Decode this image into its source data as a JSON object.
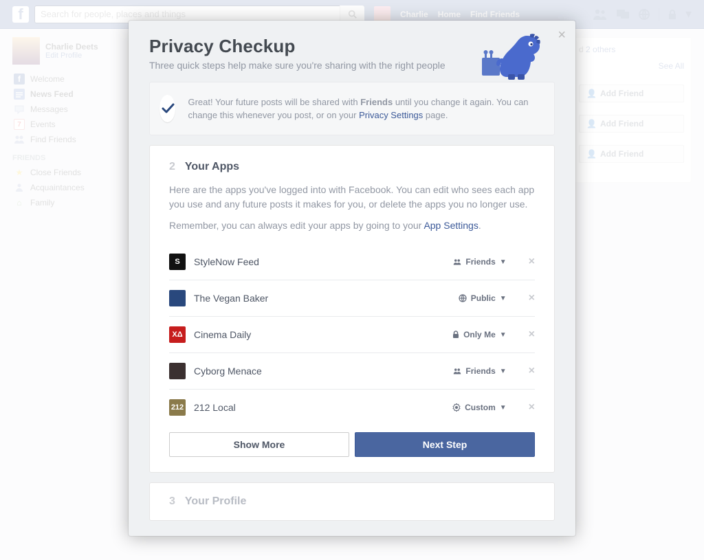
{
  "search": {
    "placeholder": "Search for people, places and things"
  },
  "nav": {
    "username": "Charlie",
    "home": "Home",
    "find_friends": "Find Friends"
  },
  "profile": {
    "name": "Charlie Deets",
    "edit": "Edit Profile"
  },
  "sidebar": {
    "items": [
      {
        "label": "Welcome"
      },
      {
        "label": "News Feed"
      },
      {
        "label": "Messages"
      },
      {
        "label": "Events"
      },
      {
        "label": "Find Friends"
      }
    ],
    "friends_header": "FRIENDS",
    "friends": [
      {
        "label": "Close Friends"
      },
      {
        "label": "Acquaintances"
      },
      {
        "label": "Family"
      }
    ]
  },
  "right": {
    "text_prefix": "d ",
    "see_all": "See All",
    "others_link": "2 others",
    "add_friend": "Add Friend"
  },
  "modal": {
    "title": "Privacy Checkup",
    "subtitle": "Three quick steps help make sure you're sharing with the right people",
    "banner": {
      "pre": "Great! Your future posts will be shared with ",
      "bold": "Friends",
      "mid": " until you change it again. You can change this whenever you post, or on your ",
      "link": "Privacy Settings",
      "post": " page."
    },
    "step2": {
      "num": "2",
      "title": "Your Apps",
      "desc1": "Here are the apps you've logged into with Facebook. You can edit who sees each app you use and any future posts it makes for you, or delete the apps you no longer use.",
      "desc2_pre": "Remember, you can always edit your apps by going to your ",
      "desc2_link": "App Settings",
      "desc2_post": ".",
      "show_more": "Show More",
      "next_step": "Next Step"
    },
    "apps": [
      {
        "name": "StyleNow Feed",
        "privacy": "Friends",
        "icon_bg": "#111",
        "icon_txt": "S",
        "icon": "friends"
      },
      {
        "name": "The Vegan Baker",
        "privacy": "Public",
        "icon_bg": "#29487d",
        "icon_txt": "",
        "icon": "globe"
      },
      {
        "name": "Cinema Daily",
        "privacy": "Only Me",
        "icon_bg": "#c61d1d",
        "icon_txt": "XΔ",
        "icon": "lock"
      },
      {
        "name": "Cyborg Menace",
        "privacy": "Friends",
        "icon_bg": "#3b3030",
        "icon_txt": "",
        "icon": "friends"
      },
      {
        "name": "212 Local",
        "privacy": "Custom",
        "icon_bg": "#8a7a4a",
        "icon_txt": "212",
        "icon": "gear"
      }
    ],
    "step3": {
      "num": "3",
      "title": "Your Profile"
    }
  }
}
